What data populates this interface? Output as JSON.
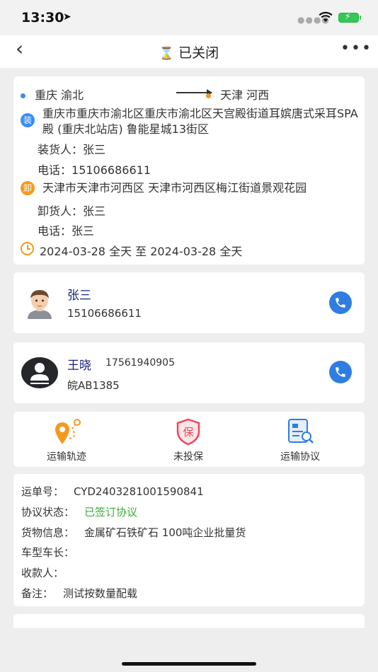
{
  "status_bar": {
    "time": "13:30",
    "location_icon": "location-arrow-icon",
    "signal_icon": "signal-dots-icon",
    "wifi_icon": "wifi-icon",
    "battery_icon": "battery-charging-icon"
  },
  "nav": {
    "back_icon": "chevron-left-icon",
    "title": "已关闭",
    "status_icon": "hourglass-icon",
    "more_icon": "more-dots-icon"
  },
  "route": {
    "origin": "重庆 渝北",
    "destination": "天津 河西",
    "load": {
      "badge": "装",
      "address": "重庆市重庆市渝北区重庆市渝北区天宫殿街道耳嫔唐式采耳SPA殿 (重庆北站店) 鲁能星城13街区",
      "contact_label": "装货人：",
      "contact": "张三",
      "phone_label": "电话：",
      "phone": "15106686611"
    },
    "unload": {
      "badge": "卸",
      "address": "天津市天津市河西区 天津市河西区梅江街道景观花园",
      "contact_label": "卸货人：",
      "contact": "张三",
      "phone_label": "电话：",
      "phone": "张三"
    },
    "time_range": "2024-03-28 全天 至 2024-03-28 全天",
    "time_icon": "clock-icon"
  },
  "shipper": {
    "name": "张三",
    "phone": "15106686611",
    "avatar": "cartoon-avatar",
    "call_icon": "phone-icon"
  },
  "driver": {
    "name": "王晓",
    "phone": "17561940905",
    "plate": "皖AB1385",
    "avatar": "default-user-avatar",
    "call_icon": "phone-icon"
  },
  "actions": [
    {
      "label": "运输轨迹",
      "icon": "track-route-icon"
    },
    {
      "label": "未投保",
      "icon": "insurance-shield-icon"
    },
    {
      "label": "运输协议",
      "icon": "agreement-document-icon"
    }
  ],
  "info": {
    "waybill_label": "运单号：",
    "waybill": "CYD2403281001590841",
    "agreement_label": "协议状态：",
    "agreement": "已签订协议",
    "cargo_label": "货物信息：",
    "cargo": "金属矿石铁矿石  100吨企业批量货",
    "vehicle_label": "车型车长：",
    "vehicle": "",
    "payee_label": "收款人：",
    "payee": "",
    "remark_label": "备注：",
    "remark": "测试按数量配载"
  },
  "colors": {
    "accent_blue": "#2f7de1",
    "accent_orange": "#f39a1e",
    "insurance_red": "#e94b5b",
    "success_green": "#3bab3b",
    "name_navy": "#1a237e"
  }
}
